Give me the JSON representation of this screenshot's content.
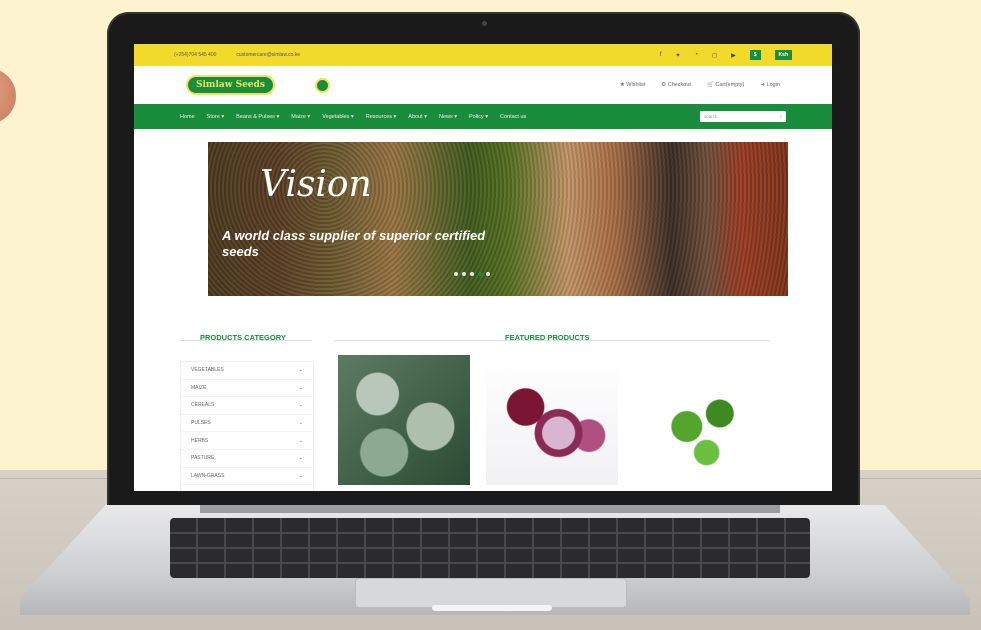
{
  "topbar": {
    "phone": "(+254)704 545 400",
    "email": "customercare@simlaw.co.ke",
    "social_icons": [
      "facebook-icon",
      "twitter-icon",
      "whatsapp-icon",
      "instagram-icon",
      "youtube-icon"
    ],
    "currency_usd": "$",
    "currency_ksh": "Ksh"
  },
  "header": {
    "logo_text": "Simlaw Seeds",
    "links": [
      "Wishlist",
      "Checkout",
      "Cart(empty)",
      "Login"
    ]
  },
  "nav": {
    "items": [
      "Home",
      "Store ▾",
      "Beans & Pulses ▾",
      "Maize ▾",
      "Vegetables ▾",
      "Resources ▾",
      "About ▾",
      "News ▾",
      "Policy ▾",
      "Contact us"
    ],
    "search_placeholder": "search"
  },
  "banner": {
    "heading": "Vision",
    "tagline": "A world class supplier of superior certified seeds"
  },
  "sections": {
    "categories_title": "PRODUCTS CATEGORY",
    "featured_title": "FEATURED PRODUCTS"
  },
  "categories": [
    "VEGETABLES",
    "MAIZE",
    "CEREALS",
    "PULSES",
    "HERBS",
    "PASTURE",
    "LAWN-GRASS"
  ],
  "featured": [
    "cabbage",
    "onion",
    "peas"
  ],
  "colors": {
    "brand_green": "#1a8d3c",
    "topbar_yellow": "#f2da2b"
  }
}
